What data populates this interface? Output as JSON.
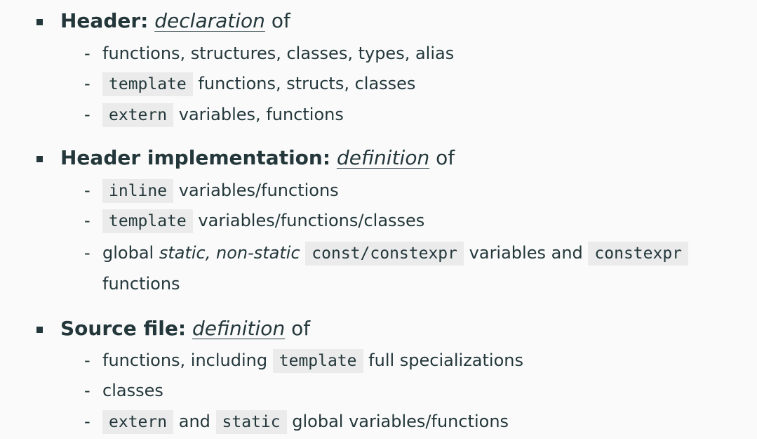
{
  "sections": [
    {
      "title": "Header:",
      "term": "declaration",
      "suffix": "of",
      "items": [
        {
          "text": "functions, structures, classes, types, alias"
        },
        {
          "code": "template",
          "text": "functions, structs, classes"
        },
        {
          "code": "extern",
          "text": "variables, functions"
        }
      ]
    },
    {
      "title": "Header implementation:",
      "term": "definition",
      "suffix": "of",
      "items": [
        {
          "code": "inline",
          "text": "variables/functions"
        },
        {
          "code": "template",
          "text": "variables/functions/classes"
        },
        {
          "prefix": "global",
          "italic": "static, non-static",
          "code": "const/constexpr",
          "middle": "variables and",
          "code2": "constexpr",
          "continuation": "functions"
        }
      ]
    },
    {
      "title": "Source file:",
      "term": "definition",
      "suffix": "of",
      "items": [
        {
          "text": "functions, including",
          "code": "template",
          "after": "full specializations"
        },
        {
          "text": "classes"
        },
        {
          "code": "extern",
          "middle": "and",
          "code2": "static",
          "after": "global variables/functions"
        }
      ]
    }
  ]
}
